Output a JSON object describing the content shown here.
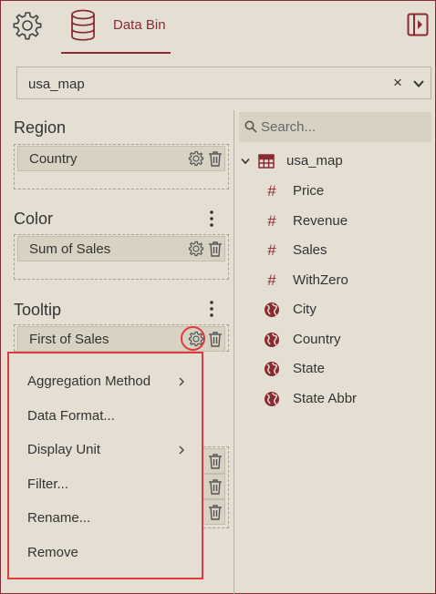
{
  "topbar": {
    "settings_icon": "gear-icon",
    "databin_icon": "database-icon",
    "databin_label": "Data Bin",
    "panel_toggle_icon": "panel-collapse-icon",
    "accent_color": "#8a2a33"
  },
  "dataset": {
    "value": "usa_map",
    "clear_label": "×"
  },
  "bindings": {
    "region": {
      "title": "Region",
      "fields": [
        "Country"
      ]
    },
    "color": {
      "title": "Color",
      "fields": [
        "Sum of Sales"
      ]
    },
    "tooltip": {
      "title": "Tooltip",
      "fields": [
        "First of Sales"
      ]
    }
  },
  "context_menu": {
    "items": [
      {
        "label": "Aggregation Method",
        "submenu": true
      },
      {
        "label": "Data Format...",
        "submenu": false
      },
      {
        "label": "Display Unit",
        "submenu": true
      },
      {
        "label": "Filter...",
        "submenu": false
      },
      {
        "label": "Rename...",
        "submenu": false
      },
      {
        "label": "Remove",
        "submenu": false
      }
    ]
  },
  "fields_panel": {
    "search_placeholder": "Search...",
    "table_name": "usa_map",
    "fields": [
      {
        "label": "Price",
        "type": "number"
      },
      {
        "label": "Revenue",
        "type": "number"
      },
      {
        "label": "Sales",
        "type": "number"
      },
      {
        "label": "WithZero",
        "type": "number"
      },
      {
        "label": "City",
        "type": "geo"
      },
      {
        "label": "Country",
        "type": "geo"
      },
      {
        "label": "State",
        "type": "geo"
      },
      {
        "label": "State Abbr",
        "type": "geo"
      }
    ],
    "number_glyph": "#",
    "highlight_color": "#e0393e"
  }
}
